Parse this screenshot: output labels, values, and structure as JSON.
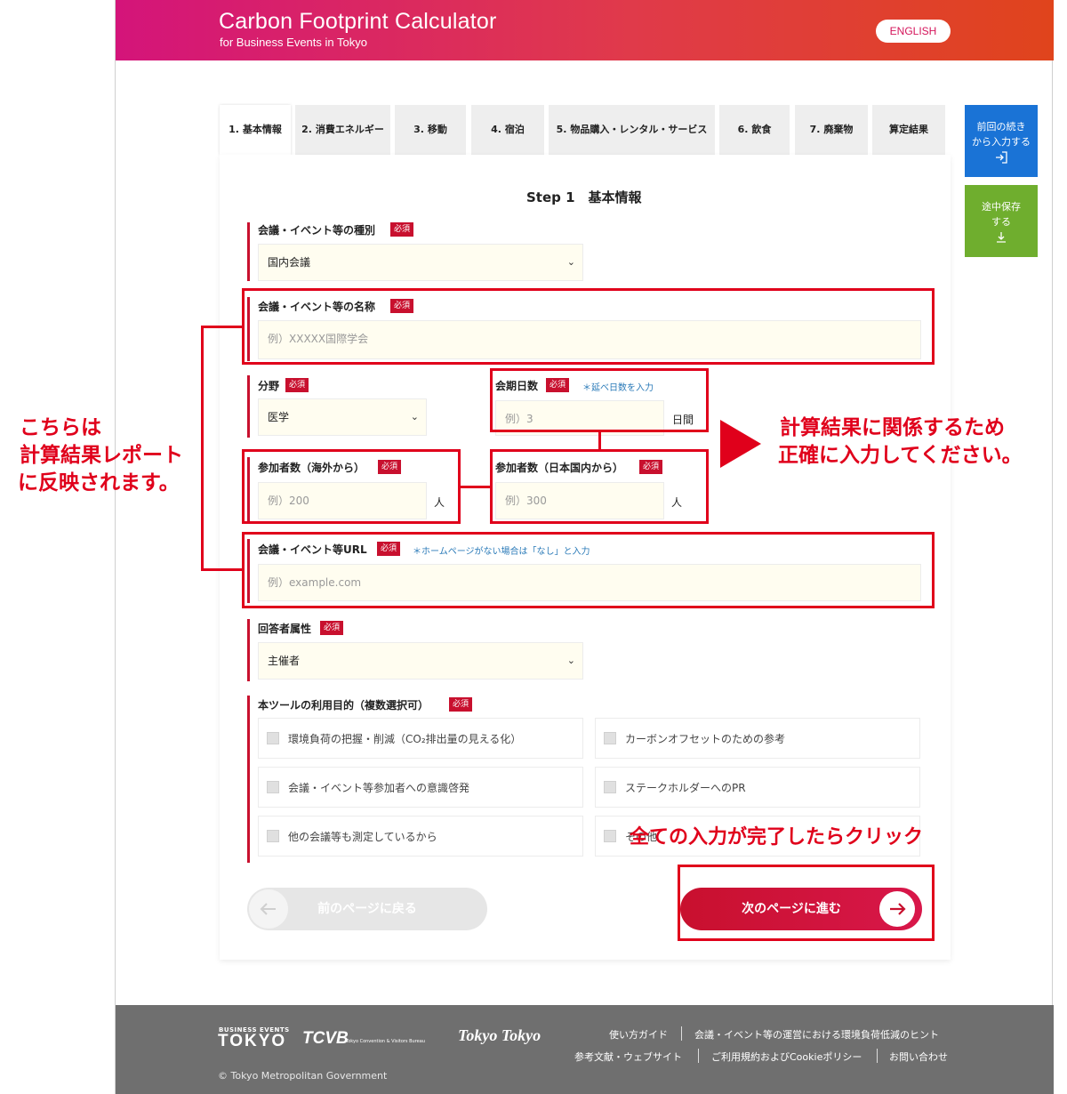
{
  "header": {
    "title": "Carbon Footprint Calculator",
    "subtitle": "for Business Events in Tokyo",
    "language_button": "ENGLISH"
  },
  "tabs": [
    {
      "label": "1. 基本情報",
      "active": true
    },
    {
      "label": "2. 消費エネルギー",
      "active": false
    },
    {
      "label": "3. 移動",
      "active": false
    },
    {
      "label": "4. 宿泊",
      "active": false
    },
    {
      "label": "5. 物品購入・レンタル・サービス",
      "active": false
    },
    {
      "label": "6. 飲食",
      "active": false
    },
    {
      "label": "7. 廃棄物",
      "active": false
    },
    {
      "label": "算定結果",
      "active": false
    }
  ],
  "side_buttons": {
    "resume_line1": "前回の続き",
    "resume_line2": "から入力する",
    "save_line1": "途中保存",
    "save_line2": "する"
  },
  "form": {
    "step_title": "Step 1　基本情報",
    "required_badge": "必須",
    "event_type": {
      "label": "会議・イベント等の種別",
      "value": "国内会議"
    },
    "event_name": {
      "label": "会議・イベント等の名称",
      "placeholder": "例）XXXXX国際学会"
    },
    "field": {
      "label": "分野",
      "value": "医学"
    },
    "days": {
      "label": "会期日数",
      "note": "＊延べ日数を入力",
      "placeholder": "例）3",
      "unit": "日間"
    },
    "overseas": {
      "label": "参加者数（海外から）",
      "placeholder": "例）200",
      "unit": "人"
    },
    "domestic": {
      "label": "参加者数（日本国内から）",
      "placeholder": "例）300",
      "unit": "人"
    },
    "url": {
      "label": "会議・イベント等URL",
      "note": "＊ホームページがない場合は「なし」と入力",
      "placeholder": "例）example.com"
    },
    "respondent": {
      "label": "回答者属性",
      "value": "主催者"
    },
    "purpose": {
      "label": "本ツールの利用目的（複数選択可）",
      "options": [
        "環境負荷の把握・削減（CO₂排出量の見える化）",
        "カーボンオフセットのための参考",
        "会議・イベント等参加者への意識啓発",
        "ステークホルダーへのPR",
        "他の会議等も測定しているから",
        "その他"
      ]
    },
    "prev_button": "前のページに戻る",
    "next_button": "次のページに進む"
  },
  "footer": {
    "logo_small": "BUSINESS EVENTS",
    "logo_tokyo": "TOKYO",
    "logo_tcvb": "TCVB",
    "logo_tcvb_sub": "Tokyo Convention & Visitors Bureau",
    "logo_tokyotokyo": "Tokyo Tokyo",
    "links_row1": [
      "使い方ガイド",
      "会議・イベント等の運営における環境負荷低減のヒント"
    ],
    "links_row2": [
      "参考文献・ウェブサイト",
      "ご利用規約およびCookieポリシー",
      "お問い合わせ"
    ],
    "copyright": "© Tokyo Metropolitan Government"
  },
  "annotations": {
    "left_line1": "こちらは",
    "left_line2": "計算結果レポート",
    "left_line3": "に反映されます。",
    "right_line1": "計算結果に関係するため",
    "right_line2": "正確に入力してください。",
    "bottom": "全ての入力が完了したらクリック"
  },
  "colors": {
    "accent": "#c8102e",
    "annotation": "#e0001b",
    "resume_button": "#1a73d6",
    "save_button": "#6fae2e"
  }
}
